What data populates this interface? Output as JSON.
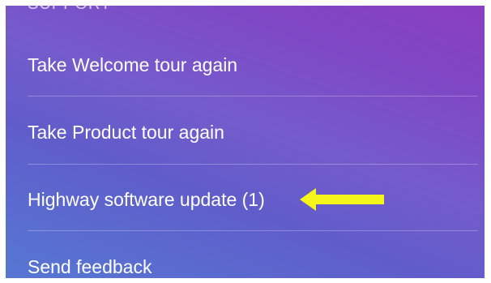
{
  "menu": {
    "section_header": "SUPPORT",
    "items": [
      {
        "label": "Take Welcome tour again"
      },
      {
        "label": "Take Product tour again"
      },
      {
        "label": "Highway software update (1)"
      },
      {
        "label": "Send feedback"
      }
    ]
  },
  "annotation": {
    "arrow_color": "#f5f51a",
    "arrow_icon": "arrow-left-icon"
  },
  "colors": {
    "gradient_top_right": "#8a3fc0",
    "gradient_bottom_left": "#4c6fd0",
    "text": "#ffffff"
  }
}
